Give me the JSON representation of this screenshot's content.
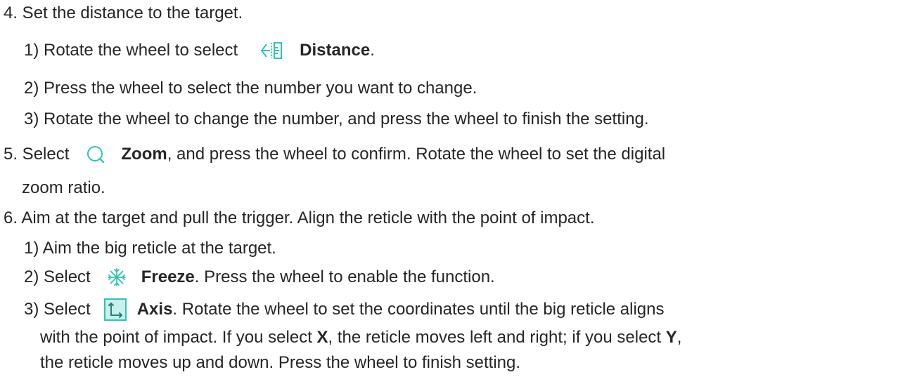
{
  "step4": {
    "heading": "4. Set the distance to the target.",
    "sub1_prefix": "1) Rotate the wheel to select",
    "sub1_icon": "distance-icon",
    "sub1_bold": "Distance",
    "sub1_suffix": ".",
    "sub2": "2) Press the wheel to select the number you want to change.",
    "sub3": "3) Rotate the wheel to change the number, and press the wheel to finish the setting."
  },
  "step5": {
    "prefix": "5. Select",
    "icon": "zoom-icon",
    "bold": "Zoom",
    "suffix": ", and press the wheel to confirm. Rotate the wheel to set the digital",
    "cont": "zoom ratio."
  },
  "step6": {
    "heading": "6. Aim at the target and pull the trigger. Align the reticle with the point of impact.",
    "sub1": "1) Aim the big reticle at the target.",
    "sub2_prefix": "2) Select",
    "sub2_icon": "freeze-icon",
    "sub2_bold": "Freeze",
    "sub2_suffix": ". Press the wheel to enable the function.",
    "sub3_prefix": "3) Select",
    "sub3_icon": "axis-icon",
    "sub3_bold": "Axis",
    "sub3_suffix": ". Rotate the wheel to set the coordinates until the big reticle aligns",
    "sub3_l2_a": "with the point of impact. If you select ",
    "sub3_l2_x": "X",
    "sub3_l2_b": ", the reticle moves left and right; if you select ",
    "sub3_l2_y": "Y",
    "sub3_l2_c": ",",
    "sub3_l3": "the reticle moves up and down. Press the wheel to finish setting."
  },
  "colors": {
    "text": "#262626",
    "icon_accent": "#2ec4b6"
  }
}
